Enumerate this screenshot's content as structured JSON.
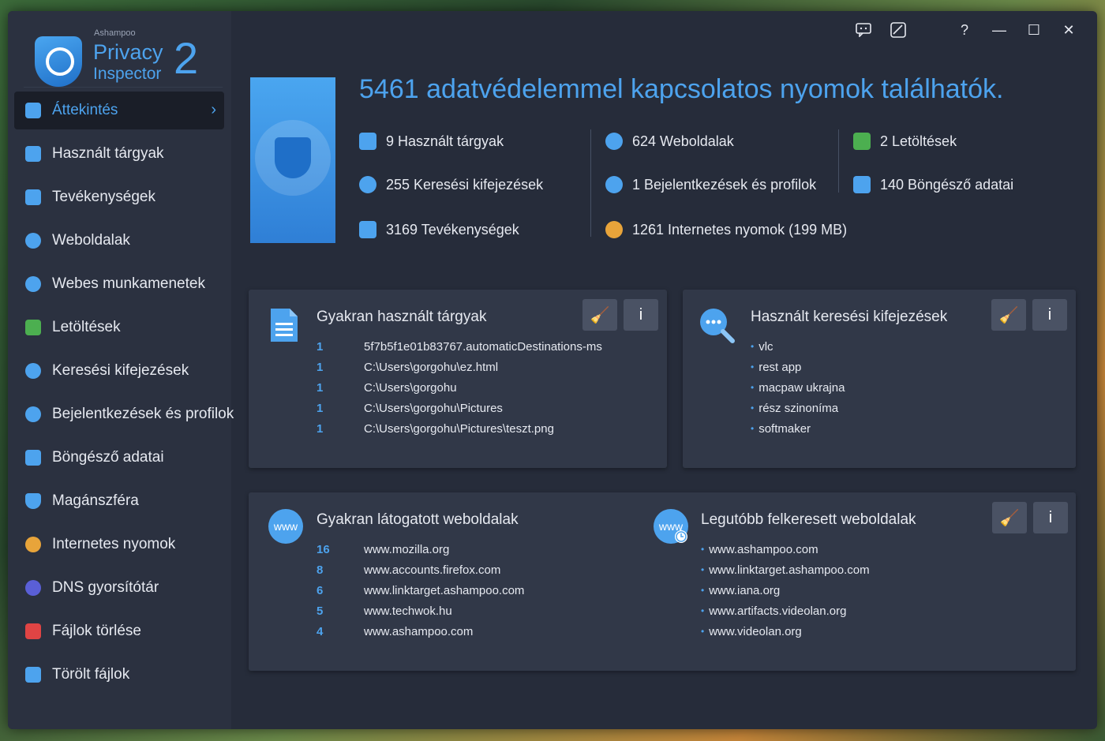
{
  "app": {
    "brand": "Ashampoo",
    "name_line1": "Privacy",
    "name_line2": "Inspector",
    "version": "2"
  },
  "titlebar": {
    "feedback_icon": "chat-icon",
    "theme_icon": "theme-icon",
    "help": "?",
    "minimize": "—",
    "maximize": "☐",
    "close": "✕"
  },
  "sidebar": {
    "items": [
      {
        "label": "Áttekintés",
        "icon": "overview-icon",
        "color": "#4da3ee"
      },
      {
        "label": "Használt tárgyak",
        "icon": "document-icon",
        "color": "#4da3ee"
      },
      {
        "label": "Tevékenységek",
        "icon": "activity-icon",
        "color": "#4da3ee"
      },
      {
        "label": "Weboldalak",
        "icon": "www-icon",
        "color": "#4da3ee"
      },
      {
        "label": "Webes munkamenetek",
        "icon": "session-icon",
        "color": "#4da3ee"
      },
      {
        "label": "Letöltések",
        "icon": "download-icon",
        "color": "#4caf50"
      },
      {
        "label": "Keresési kifejezések",
        "icon": "search-icon",
        "color": "#4da3ee"
      },
      {
        "label": "Bejelentkezések és profilok",
        "icon": "user-icon",
        "color": "#4da3ee"
      },
      {
        "label": "Böngésző adatai",
        "icon": "browser-icon",
        "color": "#4da3ee"
      },
      {
        "label": "Magánszféra",
        "icon": "shield-icon",
        "color": "#4da3ee"
      },
      {
        "label": "Internetes nyomok",
        "icon": "cookie-icon",
        "color": "#e8a43a"
      },
      {
        "label": "DNS gyorsítótár",
        "icon": "dns-icon",
        "color": "#5a5fd6"
      },
      {
        "label": "Fájlok törlése",
        "icon": "shredder-icon",
        "color": "#e04444"
      },
      {
        "label": "Törölt fájlok",
        "icon": "recycle-icon",
        "color": "#4da3ee"
      }
    ]
  },
  "hero": {
    "title": "5461 adatvédelemmel kapcsolatos nyomok találhatók."
  },
  "stats": [
    {
      "label": "9 Használt tárgyak",
      "icon": "document-icon"
    },
    {
      "label": "255 Keresési kifejezések",
      "icon": "search-icon"
    },
    {
      "label": "3169 Tevékenységek",
      "icon": "activity-icon"
    },
    {
      "label": "624 Weboldalak",
      "icon": "www-icon"
    },
    {
      "label": "1 Bejelentkezések és profilok",
      "icon": "user-icon"
    },
    {
      "label": "1261 Internetes nyomok  (199 MB)",
      "icon": "cookie-icon"
    },
    {
      "label": "2 Letöltések",
      "icon": "download-icon"
    },
    {
      "label": "140 Böngésző adatai",
      "icon": "browser-icon"
    }
  ],
  "panels": {
    "used_items": {
      "title": "Gyakran használt tárgyak",
      "rows": [
        {
          "count": "1",
          "value": "5f7b5f1e01b83767.automaticDestinations-ms"
        },
        {
          "count": "1",
          "value": "C:\\Users\\gorgohu\\ez.html"
        },
        {
          "count": "1",
          "value": "C:\\Users\\gorgohu"
        },
        {
          "count": "1",
          "value": "C:\\Users\\gorgohu\\Pictures"
        },
        {
          "count": "1",
          "value": "C:\\Users\\gorgohu\\Pictures\\teszt.png"
        }
      ]
    },
    "search_terms": {
      "title": "Használt keresési kifejezések",
      "rows": [
        "vlc",
        "rest app",
        "macpaw ukrajna",
        "rész szinoníma",
        "softmaker"
      ]
    },
    "visited_sites": {
      "title": "Gyakran látogatott weboldalak",
      "rows": [
        {
          "count": "16",
          "value": "www.mozilla.org"
        },
        {
          "count": "8",
          "value": "www.accounts.firefox.com"
        },
        {
          "count": "6",
          "value": "www.linktarget.ashampoo.com"
        },
        {
          "count": "5",
          "value": "www.techwok.hu"
        },
        {
          "count": "4",
          "value": "www.ashampoo.com"
        }
      ]
    },
    "recent_sites": {
      "title": "Legutóbb felkeresett weboldalak",
      "rows": [
        "www.ashampoo.com",
        "www.linktarget.ashampoo.com",
        "www.iana.org",
        "www.artifacts.videolan.org",
        "www.videolan.org"
      ]
    },
    "clean_button_icon": "broom-icon",
    "info_button_label": "i"
  },
  "colors": {
    "accent": "#4da3ee",
    "window_bg": "#262c3a",
    "sidebar_bg": "#2b3140",
    "panel_bg": "#313848"
  }
}
